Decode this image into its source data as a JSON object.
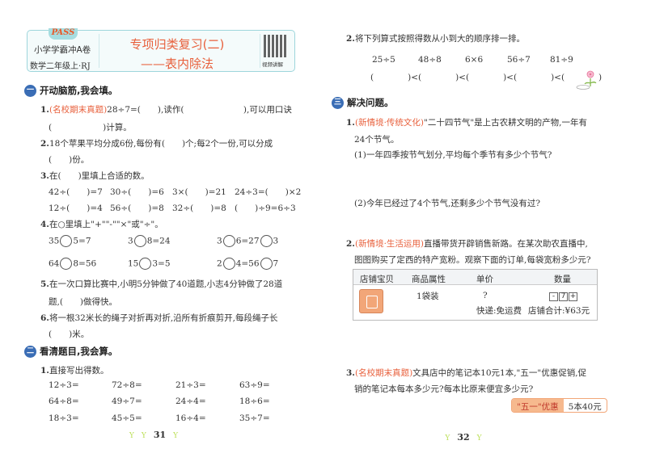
{
  "left": {
    "header": {
      "logo": "PASS",
      "series": "小学学霸冲A卷",
      "grade": "数学二年级上·RJ",
      "title": "专项归类复习(二)",
      "subtitle": "——表内除法",
      "qr_label": "视频讲解"
    },
    "sec1": {
      "num": "一",
      "title": "开动脑筋,我会填。",
      "q1": {
        "n": "1.",
        "tag": "(名校期末真题)",
        "t1": "28÷7=(　　),读作(　　　　　　　),可以用口诀",
        "t2": "(　　　　　　)计算。"
      },
      "q2": {
        "n": "2.",
        "t1": "18个苹果平均分成6份,每份有(　　)个;每2个一份,可以分成",
        "t2": "(　　)份。"
      },
      "q3": {
        "n": "3.",
        "t": "在(　　)里填上合适的数。",
        "rows": [
          [
            "42÷(　　)=7",
            "30÷(　　)=6",
            "3×(　　)=21",
            "24÷3=(　　)×2"
          ],
          [
            "12÷(　　)=4",
            "56÷(　　)=8",
            "32÷(　　)=8",
            "(　　)÷9=6÷3"
          ]
        ]
      },
      "q4": {
        "n": "4.",
        "t": "在○里填上\"+\"\"-\"\"×\"或\"÷\"。",
        "items": [
          {
            "a": "35",
            "b": "5=7"
          },
          {
            "a": "3",
            "b": "8=24"
          },
          {
            "a": "3",
            "b": "6=27",
            "c": "3"
          },
          {
            "a": "64",
            "b": "8=56"
          },
          {
            "a": "15",
            "b": "3=5"
          },
          {
            "a": "2",
            "b": "4=56",
            "c": "7"
          }
        ]
      },
      "q5": {
        "n": "5.",
        "t1": "在一次口算比赛中,小明5分钟做了40道题,小志4分钟做了28道",
        "t2": "题,(　　)做得快。"
      },
      "q6": {
        "n": "6.",
        "t1": "将一根32米长的绳子对折再对折,沿所有折痕剪开,每段绳子长",
        "t2": "(　　)米。"
      }
    },
    "sec2": {
      "num": "二",
      "title": "看清题目,我会算。",
      "q1": {
        "n": "1.",
        "t": "直接写出得数。",
        "rows": [
          [
            "12÷3=",
            "72÷8=",
            "21÷3=",
            "63÷9="
          ],
          [
            "64÷8=",
            "49÷7=",
            "24÷4=",
            "18÷6="
          ],
          [
            "18÷3=",
            "45÷5=",
            "16÷4=",
            "35÷7="
          ]
        ]
      }
    },
    "page": "31"
  },
  "right": {
    "q2": {
      "n": "2.",
      "t": "将下列算式按照得数从小到大的顺序排一排。",
      "exprs": [
        "25÷5",
        "48÷8",
        "6×6",
        "56÷7",
        "81÷9"
      ],
      "order": "(　　　　)<(　　　　)<(　　　　)<(　　　　)<(　　　　)"
    },
    "sec3": {
      "num": "三",
      "title": "解决问题。",
      "q1": {
        "n": "1.",
        "tag": "(新情境·传统文化)",
        "t1": "\"二十四节气\"是上古农耕文明的产物,一年有",
        "t2": "24个节气。",
        "s1": "(1)一年四季按节气划分,平均每个季节有多少个节气?",
        "s2": "(2)今年已经过了4个节气,还剩多少个节气没有过?"
      },
      "q2": {
        "n": "2.",
        "tag": "(新情境·生活运用)",
        "t1": "直播带货开辟销售新路。在某次助农直播中,",
        "t2": "图图购买了定西的特产宽粉。观察下面的订单,每袋宽粉多少元?",
        "table": {
          "headers": [
            "店铺宝贝",
            "商品属性",
            "单价",
            "数量"
          ],
          "attr": "1袋装",
          "price": "?",
          "qty": "7",
          "minus": "-",
          "plus": "+",
          "shipping": "快递:免运费",
          "total": "店铺合计:¥63元"
        }
      },
      "q3": {
        "n": "3.",
        "tag": "(名校期末真题)",
        "t1": "文具店中的笔记本10元1本,\"五一\"优惠促销,促",
        "t2": "销的笔记本每本多少元?每本比原来便宜多少元?",
        "badge_label": "\"五一\"优惠",
        "badge_value": "5本40元"
      }
    },
    "page": "32"
  },
  "colors": {
    "accent": "#e8603c",
    "section": "#3a6db5"
  }
}
